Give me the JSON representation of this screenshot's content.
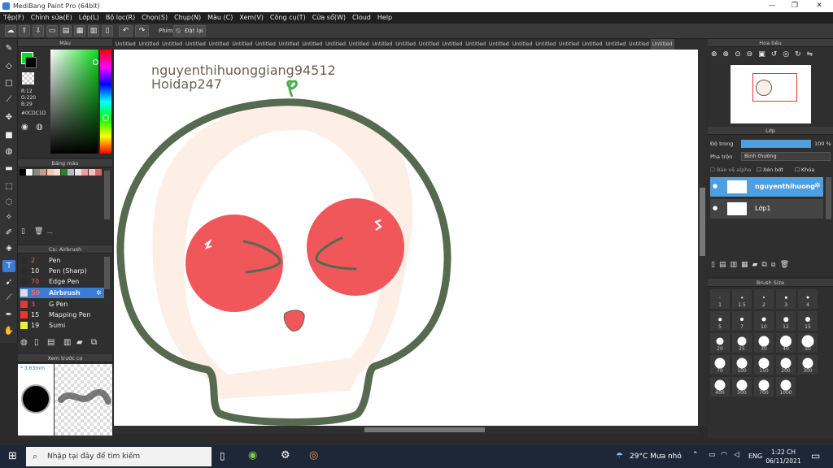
{
  "window": {
    "title": "MediBang Paint Pro (64bit)",
    "min": "—",
    "max": "❐",
    "close": "✕"
  },
  "menu": [
    "Tệp(F)",
    "Chỉnh sửa(E)",
    "Lớp(L)",
    "Bộ lọc(R)",
    "Chọn(S)",
    "Chụp(N)",
    "Màu (C)",
    "Xem(V)",
    "Công cụ(T)",
    "Cửa sổ(W)",
    "Cloud",
    "Help"
  ],
  "toolbar": {
    "key_label": "Phím",
    "reset_label": "Đặt lại"
  },
  "color_panel": {
    "title": "Màu",
    "r": "R:12",
    "g": "G:220",
    "b": "B:29",
    "hex": "#0CDC1D",
    "primary": "#0cdc1d"
  },
  "swatch_panel": {
    "title": "Bảng màu",
    "more": "---",
    "colors": [
      "#000000",
      "#ffffff",
      "#888888",
      "#c49a8a",
      "#f0c8b8",
      "#f5e0d0",
      "#2e7d32",
      "#bbbbbb",
      "#e6e6e6",
      "#e8a0a0",
      "#f5c0c0",
      "#d46a6a"
    ]
  },
  "brush_panel": {
    "title": "Cọ: Airbrush",
    "items": [
      {
        "color": "#2b2b2b",
        "num": "2",
        "name": "Pen"
      },
      {
        "color": "#2b2b2b",
        "num": "10",
        "name": "Pen (Sharp)"
      },
      {
        "color": "#2b2b2b",
        "num": "70",
        "name": "Edge Pen"
      },
      {
        "color": "#dddddd",
        "num": "50",
        "name": "Airbrush"
      },
      {
        "color": "#e33",
        "num": "3",
        "name": "G Pen"
      },
      {
        "color": "#e33",
        "num": "15",
        "name": "Mapping Pen"
      },
      {
        "color": "#ee3",
        "num": "19",
        "name": "Sumi"
      }
    ]
  },
  "preview_panel": {
    "title": "Xem trước cọ",
    "size": "* 3.63mm"
  },
  "tabs": {
    "label": "Untitled",
    "count": 24
  },
  "canvas": {
    "line1": "nguyenthihuonggiang94512",
    "line2": "Hoidap247",
    "outline": "#566a50",
    "cheek": "#f0575a",
    "blush": "#fdeee6"
  },
  "nav_panel": {
    "title": "Hoa tiêu"
  },
  "layer_panel": {
    "title": "Lớp",
    "opacity_label": "Độ trong",
    "opacity_value": "100 %",
    "blend_label": "Pha trộn",
    "blend_value": "Bình thường",
    "alpha_lock": "Bảo vệ alpha",
    "clip": "Xén bớt",
    "lock": "Khóa",
    "layers": [
      {
        "name": "nguyenthihuong"
      },
      {
        "name": "Lớp1"
      }
    ]
  },
  "brush_size": {
    "title": "Brush Size",
    "sizes": [
      "1",
      "1.5",
      "2",
      "3",
      "4",
      "5",
      "7",
      "10",
      "12",
      "15",
      "20",
      "25",
      "30",
      "40",
      "50",
      "70",
      "100",
      "150",
      "200",
      "300",
      "400",
      "500",
      "700",
      "1000"
    ]
  },
  "taskbar": {
    "search": "Nhập tại đây để tìm kiếm",
    "weather": "29°C  Mưa nhỏ",
    "lang": "ENG",
    "time": "1:22 CH",
    "date": "06/11/2021"
  }
}
